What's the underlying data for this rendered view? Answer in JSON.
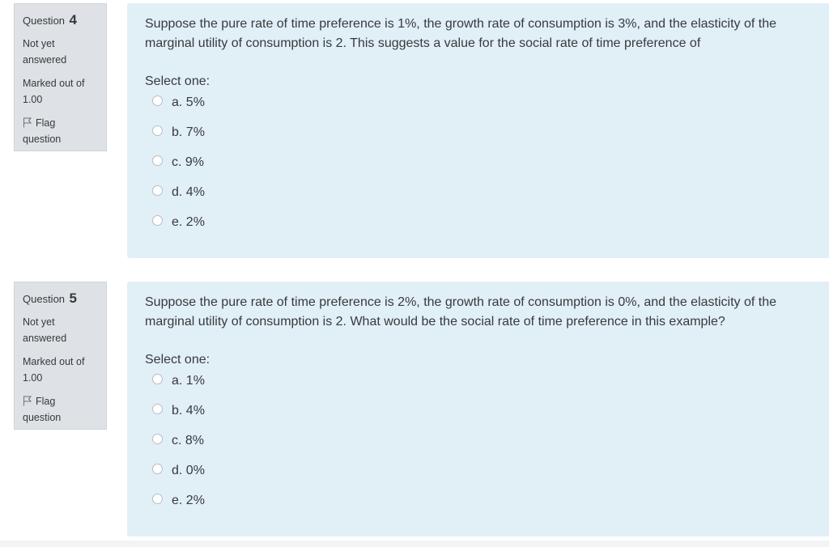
{
  "questions": [
    {
      "number_label": "Question",
      "number": "4",
      "state": "Not yet answered",
      "grade": "Marked out of 1.00",
      "flag_label": "Flag question",
      "text": "Suppose the pure rate of time preference is 1%, the growth rate of consumption is 3%, and the elasticity of the marginal utility of consumption is 2. This suggests a value for the social rate of time preference of",
      "prompt": "Select one:",
      "answers": [
        "a. 5%",
        "b. 7%",
        "c. 9%",
        "d. 4%",
        "e. 2%"
      ]
    },
    {
      "number_label": "Question",
      "number": "5",
      "state": "Not yet answered",
      "grade": "Marked out of 1.00",
      "flag_label": "Flag question",
      "text": "Suppose the pure rate of time preference is 2%, the growth rate of consumption is 0%, and the elasticity of the marginal utility of consumption is 2. What would be the social rate of time preference in this example?",
      "prompt": "Select one:",
      "answers": [
        "a. 1%",
        "b. 4%",
        "c. 8%",
        "d. 0%",
        "e. 2%"
      ]
    }
  ]
}
